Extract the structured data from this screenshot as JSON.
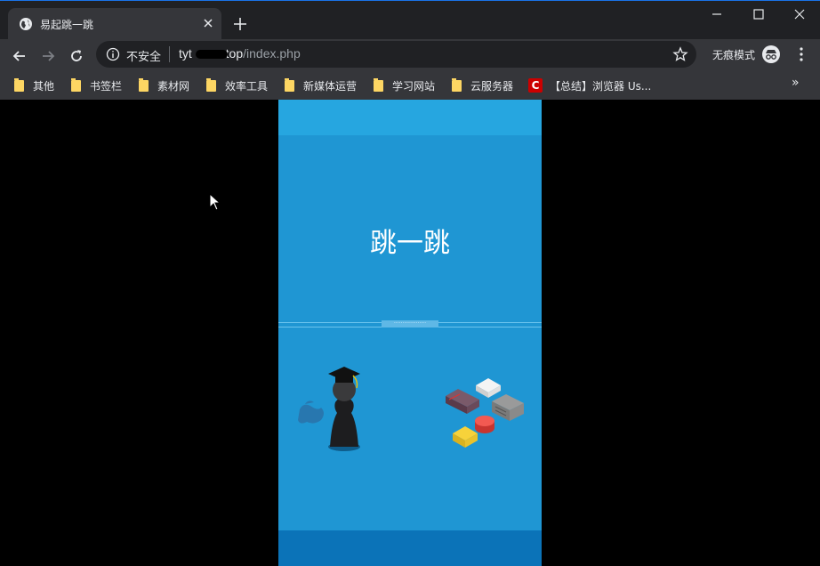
{
  "tab": {
    "title": "易起跳一跳",
    "close_label": "×"
  },
  "omnibox": {
    "security_label": "不安全",
    "url_host": "tyt",
    "url_domain": ".top",
    "url_path": "/index.php"
  },
  "incognito": {
    "label": "无痕模式"
  },
  "bookmarks": [
    {
      "label": "其他",
      "icon": "folder-icon"
    },
    {
      "label": "书签栏",
      "icon": "folder-icon"
    },
    {
      "label": "素材网",
      "icon": "folder-icon"
    },
    {
      "label": "效率工具",
      "icon": "folder-icon"
    },
    {
      "label": "新媒体运营",
      "icon": "folder-icon"
    },
    {
      "label": "学习网站",
      "icon": "folder-icon"
    },
    {
      "label": "云服务器",
      "icon": "folder-icon"
    },
    {
      "label": "【总结】浏览器 Us...",
      "icon": "csdn-icon"
    }
  ],
  "bookmarks_more": "»",
  "game": {
    "title": "跳一跳",
    "banner_text": "···················"
  },
  "colors": {
    "game_bg": "#1f96d3",
    "chrome_dark": "#202124",
    "chrome_mid": "#35363a",
    "folder": "#fdd663"
  }
}
